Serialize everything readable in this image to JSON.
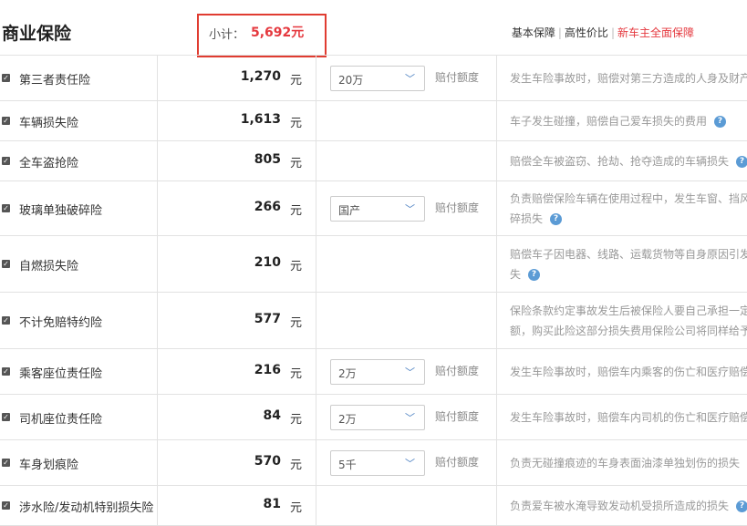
{
  "header": {
    "title": "商业保险",
    "subtotal_label": "小计：",
    "subtotal_value": "5,692元",
    "plans": [
      {
        "label": "基本保障",
        "highlight": false
      },
      {
        "label": "高性价比",
        "highlight": false
      },
      {
        "label": "新车主全面保障",
        "highlight": true
      }
    ]
  },
  "unit": "元",
  "coverage_label": "赔付额度",
  "rows": [
    {
      "name": "第三者责任险",
      "price": "1,270",
      "select": "20万",
      "desc": [
        "发生车险事故时，赔偿对第三方造成的人身及财产"
      ],
      "help": false
    },
    {
      "name": "车辆损失险",
      "price": "1,613",
      "select": null,
      "desc": [
        "车子发生碰撞，赔偿自己爱车损失的费用"
      ],
      "help": true
    },
    {
      "name": "全车盗抢险",
      "price": "805",
      "select": null,
      "desc": [
        "赔偿全车被盗窃、抢劫、抢夺造成的车辆损失"
      ],
      "help": true
    },
    {
      "name": "玻璃单独破碎险",
      "price": "266",
      "select": "国产",
      "desc": [
        "负责赔偿保险车辆在使用过程中，发生车窗、挡风",
        "碎损失"
      ],
      "help": true
    },
    {
      "name": "自燃损失险",
      "price": "210",
      "select": null,
      "desc": [
        "赔偿车子因电器、线路、运载货物等自身原因引发",
        "失"
      ],
      "help": true
    },
    {
      "name": "不计免赔特约险",
      "price": "577",
      "select": null,
      "desc": [
        "保险条款约定事故发生后被保险人要自己承担一定",
        "额，购买此险这部分损失费用保险公司将同样给予"
      ],
      "help": false
    },
    {
      "name": "乘客座位责任险",
      "price": "216",
      "select": "2万",
      "desc": [
        "发生车险事故时，赔偿车内乘客的伤亡和医疗赔偿"
      ],
      "help": false
    },
    {
      "name": "司机座位责任险",
      "price": "84",
      "select": "2万",
      "desc": [
        "发生车险事故时，赔偿车内司机的伤亡和医疗赔偿"
      ],
      "help": false
    },
    {
      "name": "车身划痕险",
      "price": "570",
      "select": "5千",
      "desc": [
        "负责无碰撞痕迹的车身表面油漆单独划伤的损失"
      ],
      "help": false
    },
    {
      "name": "涉水险/发动机特别损失险",
      "price": "81",
      "select": null,
      "desc": [
        "负责爱车被水淹导致发动机受损所造成的损失"
      ],
      "help": true
    }
  ],
  "icons": {
    "checkbox": "checkbox-checked-icon",
    "chevron": "chevron-down-icon",
    "help": "question-icon"
  },
  "colors": {
    "accent": "#e5393f",
    "border": "#e2e2e2",
    "help": "#5b9bd5"
  }
}
